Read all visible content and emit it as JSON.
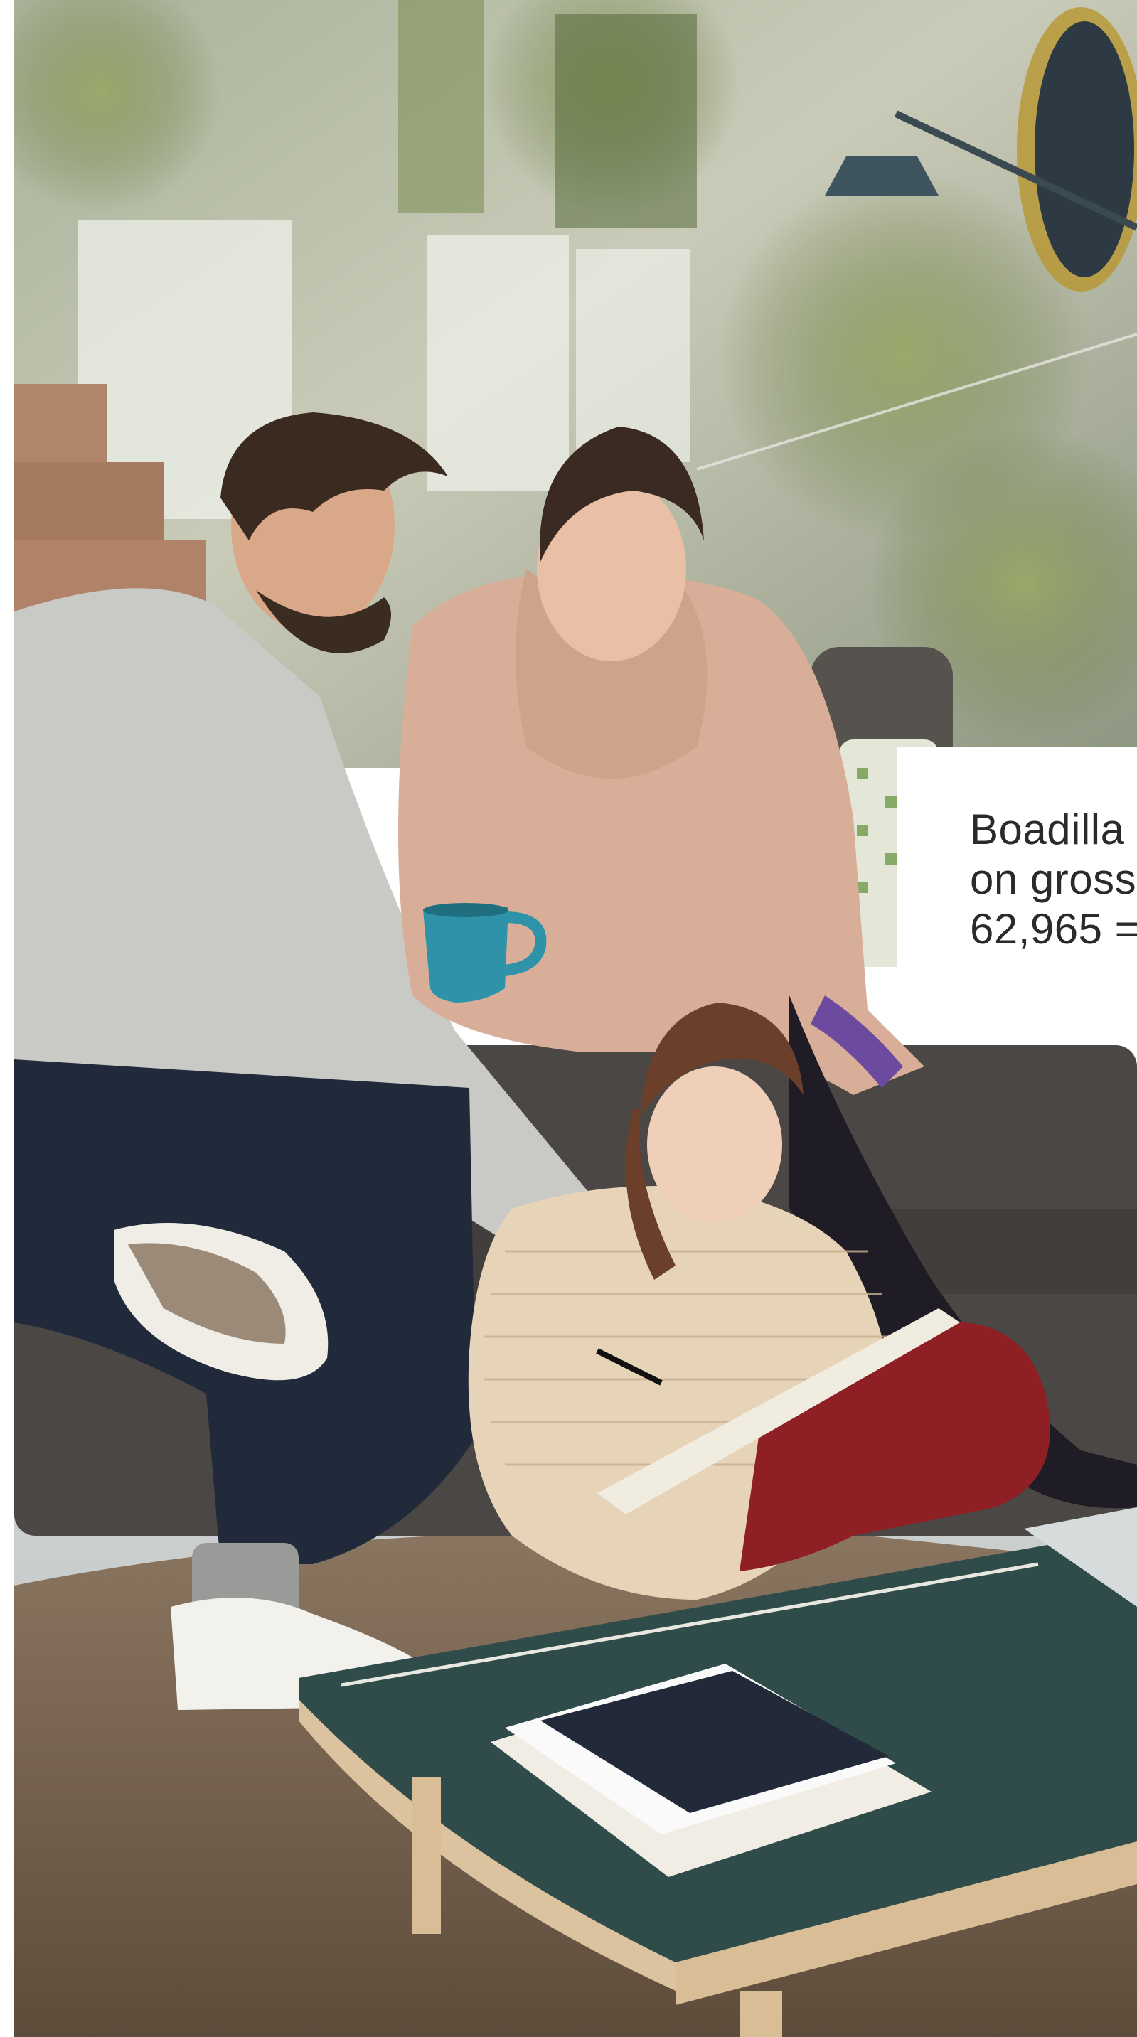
{
  "info_card": {
    "lines": [
      "Boadilla",
      "on gross",
      "62,965 ="
    ]
  },
  "colors": {
    "card_background": "#ffffff",
    "text": "#2a2a2a",
    "sweater_grey": "#c9c9c6",
    "sweater_pink": "#d8ae98",
    "mug_teal": "#2e93a8",
    "sofa": "#4b4744",
    "rug": "#7a6753",
    "table_top": "#2f4c4a",
    "table_wood": "#dcc3a0"
  }
}
